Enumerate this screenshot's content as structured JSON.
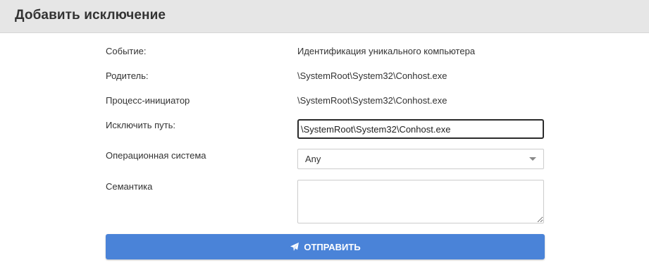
{
  "dialog": {
    "title": "Добавить исключение"
  },
  "form": {
    "event_label": "Событие:",
    "event_value": "Идентификация уникального компьютера",
    "parent_label": "Родитель:",
    "parent_value": "\\SystemRoot\\System32\\Conhost.exe",
    "initiator_label": "Процесс-инициатор",
    "initiator_value": "\\SystemRoot\\System32\\Conhost.exe",
    "exclude_path_label": "Исключить путь:",
    "exclude_path_value": "\\SystemRoot\\System32\\Conhost.exe",
    "os_label": "Операционная система",
    "os_selected": "Any",
    "semantics_label": "Семантика",
    "semantics_value": ""
  },
  "actions": {
    "submit_label": "ОТПРАВИТЬ",
    "submit_icon": "paper-plane-icon"
  },
  "colors": {
    "header_bg": "#e6e6e6",
    "button_bg": "#4a83d8",
    "text": "#333333"
  }
}
